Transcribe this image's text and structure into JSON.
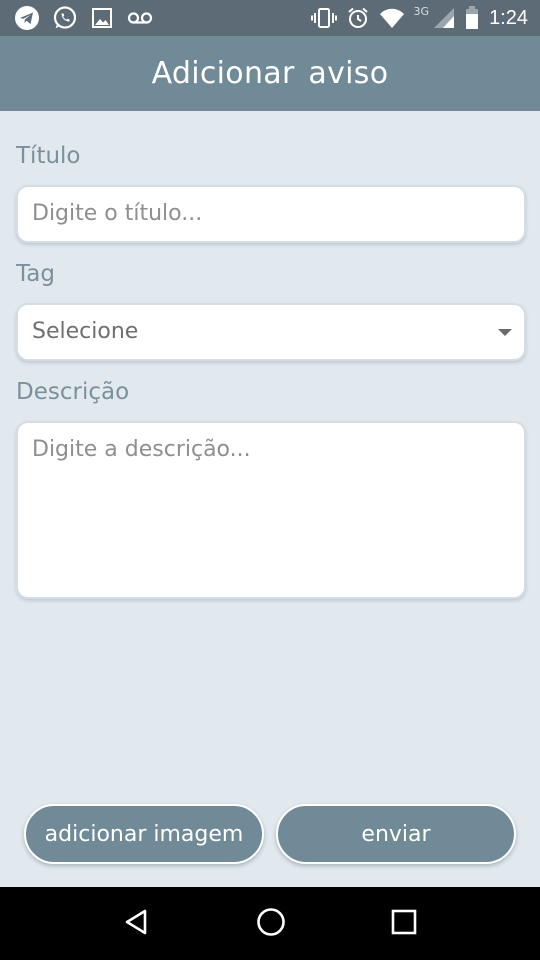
{
  "status_bar": {
    "time": "1:24",
    "network_label": "3G",
    "icons": [
      "telegram-icon",
      "whatsapp-icon",
      "image-icon",
      "voicemail-icon",
      "vibrate-icon",
      "alarm-icon",
      "wifi-icon",
      "signal-icon",
      "battery-icon"
    ]
  },
  "app_bar": {
    "title": "Adicionar aviso"
  },
  "form": {
    "title_label": "Título",
    "title_placeholder": "Digite o título...",
    "tag_label": "Tag",
    "tag_selected": "Selecione",
    "description_label": "Descrição",
    "description_placeholder": "Digite a descrição..."
  },
  "actions": {
    "add_image_label": "adicionar imagem",
    "send_label": "enviar"
  },
  "colors": {
    "status_bar": "#5c6b75",
    "app_bar": "#718a98",
    "background": "#e1e9ef",
    "label_text": "#7a909c",
    "button": "#718a98",
    "nav_bar": "#000000"
  },
  "nav_bar": {
    "icons": [
      "back-icon",
      "home-icon",
      "recents-icon"
    ]
  }
}
